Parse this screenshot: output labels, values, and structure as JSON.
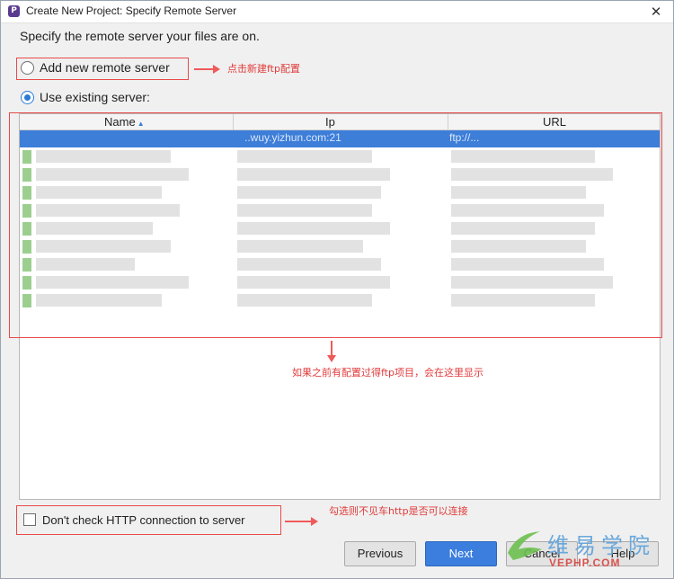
{
  "window": {
    "title": "Create New Project: Specify Remote Server",
    "close_glyph": "✕"
  },
  "heading": "Specify the remote server your files are on.",
  "options": {
    "add_new": "Add new remote server",
    "use_existing": "Use existing server:"
  },
  "annotations": {
    "add_new_note": "点击新建ftp配置",
    "list_note": "如果之前有配置过得ftp项目，会在这里显示",
    "check_note": "勾选则不见车http是否可以连接"
  },
  "table": {
    "columns": [
      "Name",
      "Ip",
      "URL"
    ],
    "selected_row": {
      "ip": "..wuy.yizhun.com:21",
      "url": "ftp://..."
    }
  },
  "checkbox": {
    "label": "Don't check HTTP connection to server"
  },
  "buttons": {
    "previous": "Previous",
    "next": "Next",
    "cancel": "Cancel",
    "help": "Help"
  },
  "watermark": {
    "text": "维易学院",
    "sub": "VEPHP.COM"
  },
  "colors": {
    "accent": "#3d7ed8",
    "annotation_red": "#e84a4a"
  },
  "icons": {
    "app": "jetbrains-app-icon",
    "sort": "sort-ascending-icon"
  }
}
